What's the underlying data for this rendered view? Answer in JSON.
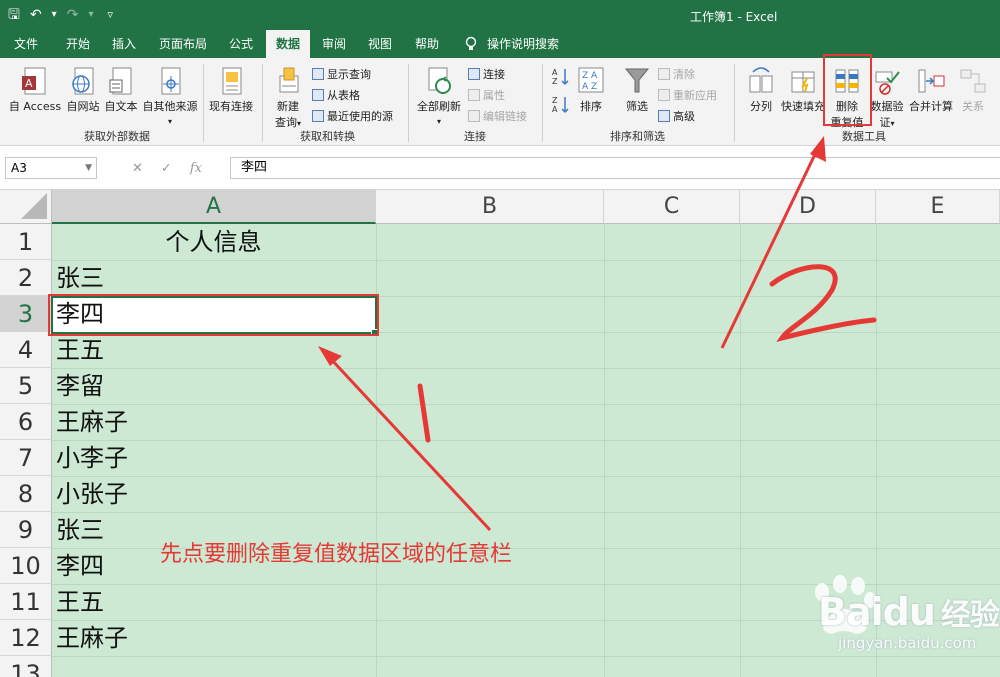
{
  "window": {
    "title": "工作簿1  -  Excel"
  },
  "qat": {
    "save": "🖫",
    "undo": "↶",
    "undo_dd": "▾",
    "redo": "↷",
    "redo_dd": "▾",
    "customize": "▿"
  },
  "tabs": [
    {
      "label": "文件"
    },
    {
      "label": "开始"
    },
    {
      "label": "插入"
    },
    {
      "label": "页面布局"
    },
    {
      "label": "公式"
    },
    {
      "label": "数据",
      "active": true
    },
    {
      "label": "审阅"
    },
    {
      "label": "视图"
    },
    {
      "label": "帮助"
    },
    {
      "label": "操作说明搜索"
    }
  ],
  "ribbon": {
    "get_external": {
      "group": "获取外部数据",
      "access": "自 Access",
      "web": "自网站",
      "text": "自文本",
      "other": "自其他来源",
      "existing": "现有连接"
    },
    "get_transform": {
      "group": "获取和转换",
      "new_query_1": "新建",
      "new_query_2": "查询",
      "show_queries": "显示查询",
      "from_table": "从表格",
      "recent_sources": "最近使用的源"
    },
    "connections": {
      "group": "连接",
      "refresh_all": "全部刷新",
      "connections": "连接",
      "properties": "属性",
      "edit_links": "编辑链接"
    },
    "sort_filter": {
      "group": "排序和筛选",
      "sort": "排序",
      "filter": "筛选",
      "clear": "清除",
      "reapply": "重新应用",
      "advanced": "高级"
    },
    "data_tools": {
      "group": "数据工具",
      "text_to_columns": "分列",
      "flash_fill": "快速填充",
      "remove_dup_1": "删除",
      "remove_dup_2": "重复值",
      "validation_1": "数据验",
      "validation_2": "证",
      "consolidate": "合并计算",
      "relationships": "关系"
    }
  },
  "formula_bar": {
    "name_box": "A3",
    "formula": "李四",
    "fx": "fx",
    "cancel": "✕",
    "enter": "✓"
  },
  "columns": [
    "A",
    "B",
    "C",
    "D",
    "E"
  ],
  "rows": [
    "1",
    "2",
    "3",
    "4",
    "5",
    "6",
    "7",
    "8",
    "9",
    "10",
    "11",
    "12",
    "13"
  ],
  "cells": {
    "header": "个人信息",
    "names": [
      "张三",
      "李四",
      "王五",
      "李留",
      "王麻子",
      "小李子",
      "小张子",
      "张三",
      "李四",
      "王五",
      "王麻子"
    ]
  },
  "annotation": {
    "text": "先点要删除重复值数据区域的任意栏",
    "mark1": "1",
    "mark2": "2"
  },
  "colors": {
    "excel_green": "#217346",
    "annotation_red": "#e53935",
    "cell_bg": "#cde8d3"
  },
  "watermark": {
    "brand": "Bai",
    "brand2": "du",
    "brand_cn": "经验",
    "url": "jingyan.baidu.com"
  }
}
